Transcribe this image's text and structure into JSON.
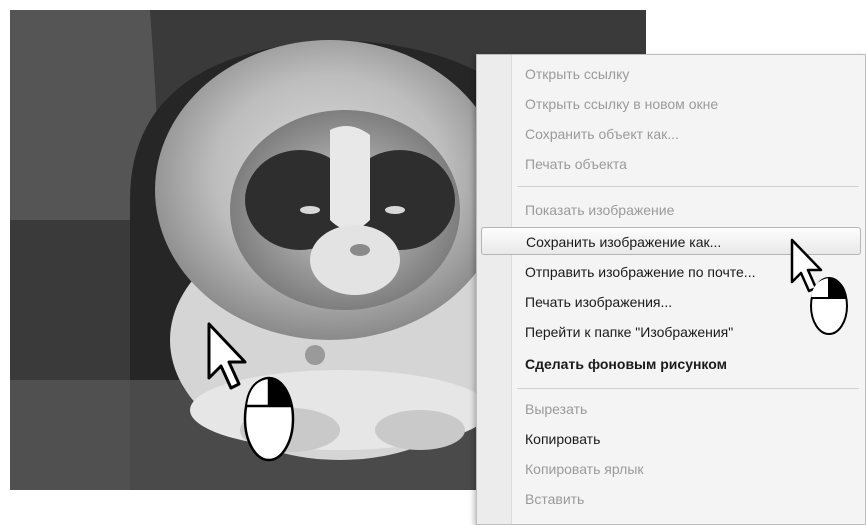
{
  "context_menu": {
    "items": [
      {
        "label": "Открыть ссылку",
        "state": "disabled"
      },
      {
        "label": "Открыть ссылку в новом окне",
        "state": "disabled"
      },
      {
        "label": "Сохранить объект как...",
        "state": "disabled"
      },
      {
        "label": "Печать объекта",
        "state": "disabled"
      },
      {
        "label": "Показать изображение",
        "state": "disabled"
      },
      {
        "label": "Сохранить изображение как...",
        "state": "highlighted"
      },
      {
        "label": "Отправить изображение по почте...",
        "state": "enabled"
      },
      {
        "label": "Печать изображения...",
        "state": "enabled"
      },
      {
        "label": "Перейти к папке \"Изображения\"",
        "state": "enabled"
      },
      {
        "label": "Сделать фоновым рисунком",
        "state": "enabled"
      },
      {
        "label": "Вырезать",
        "state": "disabled"
      },
      {
        "label": "Копировать",
        "state": "enabled"
      },
      {
        "label": "Копировать ярлык",
        "state": "disabled"
      },
      {
        "label": "Вставить",
        "state": "disabled"
      }
    ]
  },
  "icons": {
    "image_cursor": "arrow-cursor-icon",
    "image_mouse": "mouse-left-click-icon",
    "menu_cursor": "arrow-cursor-icon",
    "menu_mouse": "mouse-right-click-icon"
  }
}
